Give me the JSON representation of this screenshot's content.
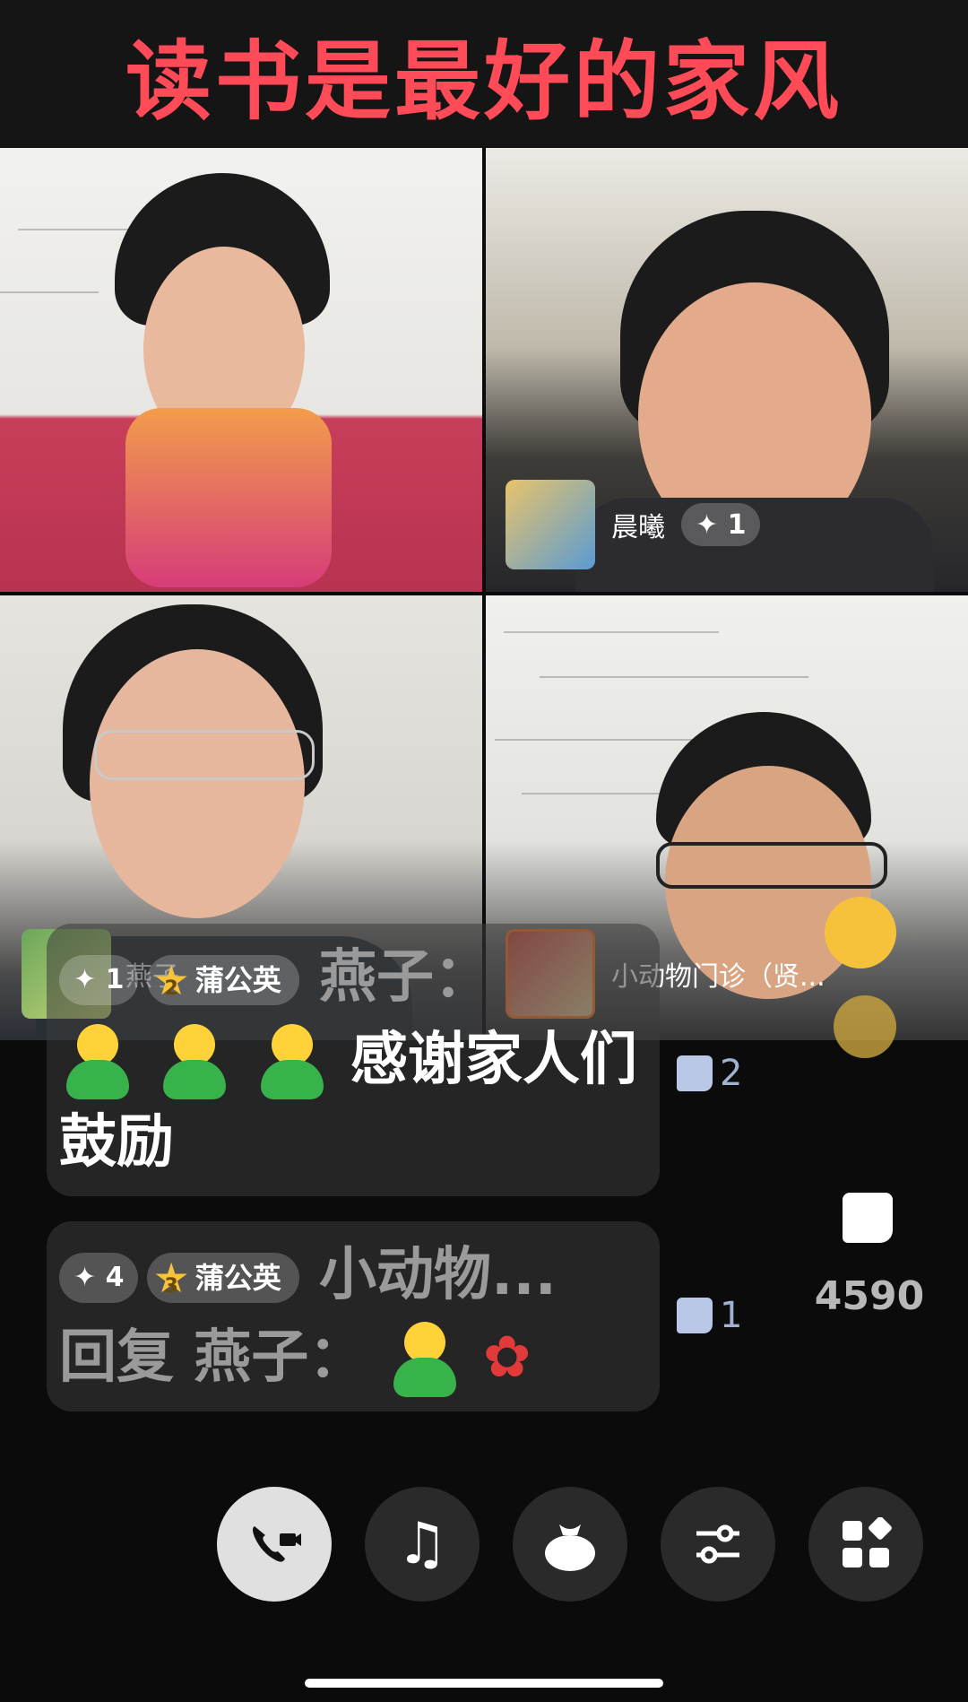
{
  "header": {
    "title": "读书是最好的家风"
  },
  "participants": [
    {
      "name": "晨曦",
      "heart_label": "✦ 1"
    },
    {
      "name": "燕子",
      "heart_label": "✦ 1",
      "fan_level": "2",
      "fan_badge": "蒲公英"
    },
    {
      "name": "小动物门诊（贤...",
      "heart_label": ""
    }
  ],
  "chat": [
    {
      "speaker": "燕子",
      "separator": "：",
      "text": "感谢家人们鼓励",
      "likes": "2"
    },
    {
      "heart_label": "✦ 4",
      "fan_level": "3",
      "fan_badge": "蒲公英",
      "speaker": "小动物...",
      "text": "回复 燕子：",
      "likes": "1"
    }
  ],
  "side": {
    "like_count": "4590"
  },
  "dock": [
    {
      "name": "video-call-icon",
      "active": true
    },
    {
      "name": "music-icon",
      "active": false
    },
    {
      "name": "gift-bag-icon",
      "active": false
    },
    {
      "name": "sliders-icon",
      "active": false
    },
    {
      "name": "apps-grid-icon",
      "active": false
    }
  ],
  "colors": {
    "title": "#ff4b57",
    "background": "#0b0b0b",
    "fan_star": "#f6c33a"
  }
}
